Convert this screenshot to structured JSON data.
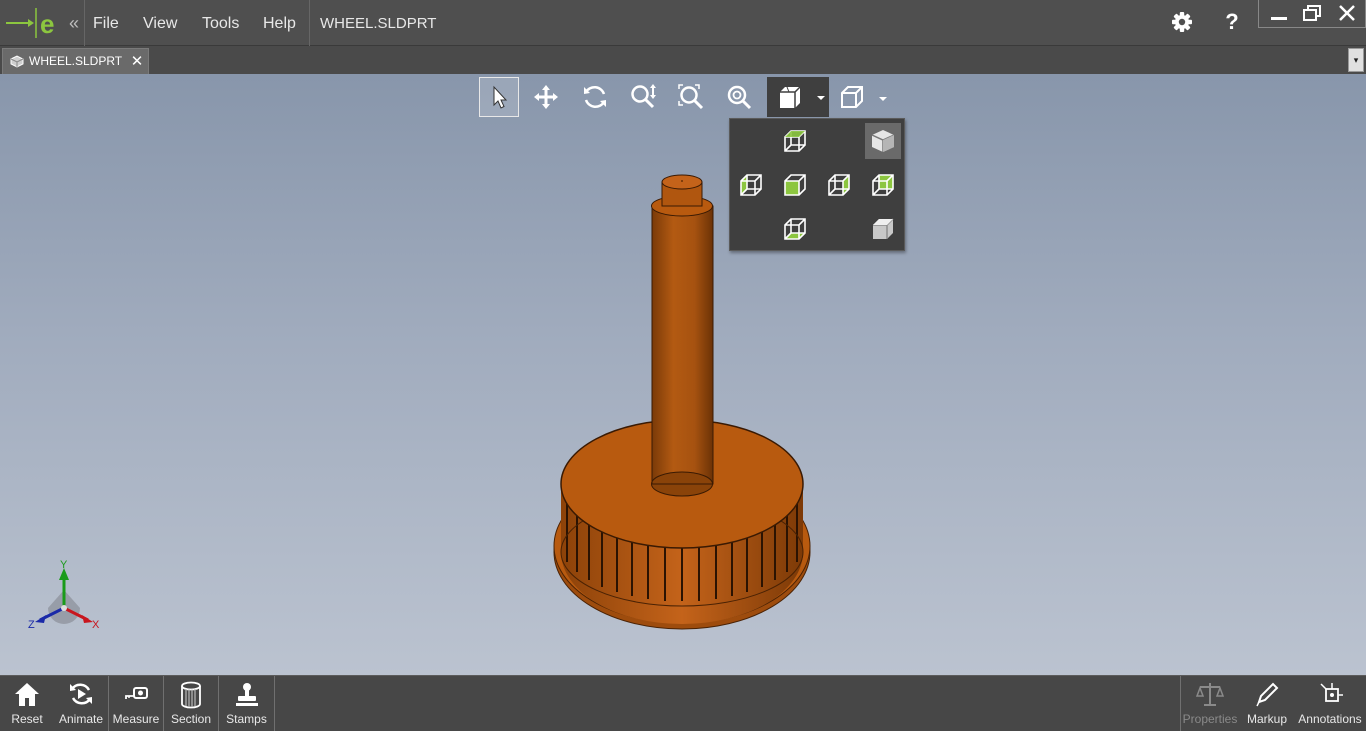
{
  "titlebar": {
    "menu": [
      {
        "label": "File"
      },
      {
        "label": "View"
      },
      {
        "label": "Tools"
      },
      {
        "label": "Help"
      }
    ],
    "document_title": "WHEEL.SLDPRT",
    "collapse_glyph": "«",
    "help_glyph": "?",
    "icons": {
      "logo": "edrawings-logo",
      "settings": "gear-icon",
      "help": "help-icon",
      "minimize": "minimize-icon",
      "restore": "restore-icon",
      "close": "close-icon"
    }
  },
  "tabs": [
    {
      "label": "WHEEL.SLDPRT",
      "close_glyph": "✕",
      "icon": "part-icon"
    }
  ],
  "tab_dropdown_glyph": "▾",
  "view_toolbar": {
    "tools": [
      {
        "name": "select",
        "icon": "pointer-icon",
        "active": true
      },
      {
        "name": "pan",
        "icon": "pan-icon"
      },
      {
        "name": "rotate",
        "icon": "rotate-icon"
      },
      {
        "name": "zoom",
        "icon": "zoom-icon"
      },
      {
        "name": "zoom-to-area",
        "icon": "zoom-area-icon"
      },
      {
        "name": "zoom-to-fit",
        "icon": "zoom-fit-icon"
      },
      {
        "name": "display-style",
        "icon": "display-style-icon",
        "open": true
      },
      {
        "name": "view-orientation",
        "icon": "view-orientation-icon"
      }
    ]
  },
  "display_style_menu": {
    "items": [
      {
        "icon": "wireframe-top-icon"
      },
      {
        "icon": "shaded-cube-icon",
        "selected": true
      },
      {
        "icon": "wireframe-left-icon"
      },
      {
        "icon": "shaded-face-icon"
      },
      {
        "icon": "wireframe-right-icon"
      },
      {
        "icon": "shaded-edges-icon"
      },
      {
        "icon": "wireframe-bottom-icon"
      },
      {
        "icon": "shaded-gray-icon"
      }
    ]
  },
  "triad": {
    "x_label": "X",
    "y_label": "Y",
    "z_label": "Z"
  },
  "model": {
    "color": "#b85a0f",
    "name": "wheel"
  },
  "bottom_toolbar": {
    "left": [
      {
        "label": "Reset",
        "icon": "home-icon"
      },
      {
        "label": "Animate",
        "icon": "animate-icon"
      },
      {
        "label": "Measure",
        "icon": "measure-icon"
      },
      {
        "label": "Section",
        "icon": "section-icon"
      },
      {
        "label": "Stamps",
        "icon": "stamps-icon"
      }
    ],
    "right": [
      {
        "label": "Properties",
        "icon": "properties-icon",
        "disabled": true
      },
      {
        "label": "Markup",
        "icon": "markup-icon"
      },
      {
        "label": "Annotations",
        "icon": "annotations-icon"
      }
    ]
  },
  "colors": {
    "chrome": "#4f4f4f",
    "accent_green": "#8cc63f",
    "model_orange": "#b85a0f"
  }
}
